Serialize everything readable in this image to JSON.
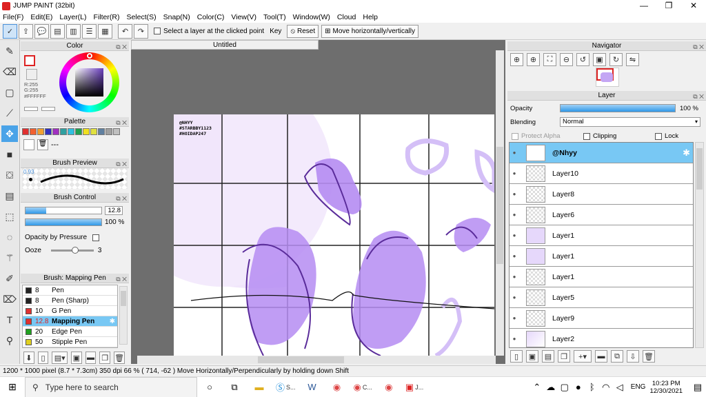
{
  "window": {
    "title": "JUMP PAINT (32bit)",
    "min": "—",
    "max": "❐",
    "close": "✕"
  },
  "menu": [
    "File(F)",
    "Edit(E)",
    "Layer(L)",
    "Filter(R)",
    "Select(S)",
    "Snap(N)",
    "Color(C)",
    "View(V)",
    "Tool(T)",
    "Window(W)",
    "Cloud",
    "Help"
  ],
  "toolbar": {
    "select_layer_label": "Select a layer at the clicked point",
    "key_label": "Key",
    "reset_label": "Reset",
    "move_label": "Move horizontally/vertically"
  },
  "color_panel": {
    "title": "Color",
    "r": "R:255",
    "g": "G:255",
    "hex": "#FFFFFF"
  },
  "palette_panel": {
    "title": "Palette",
    "extra": "---",
    "swatches": [
      "#e03030",
      "#f06030",
      "#f0a030",
      "#3030c0",
      "#a030c0",
      "#30a0a0",
      "#30c0e0",
      "#20a050",
      "#f0e020",
      "#e0e040",
      "#6080a0",
      "#a0a0a0",
      "#c0c0c0"
    ]
  },
  "brush_preview": {
    "title": "Brush Preview",
    "size_label": "0.93"
  },
  "brush_control": {
    "title": "Brush Control",
    "size_value": "12.8",
    "opacity_value": "100 %",
    "opacity_by_pressure": "Opacity by Pressure",
    "ooze_label": "Ooze",
    "ooze_value": "3"
  },
  "brush_list": {
    "title": "Brush: Mapping Pen",
    "items": [
      {
        "size": "8",
        "name": "Pen",
        "color": "#222222"
      },
      {
        "size": "8",
        "name": "Pen (Sharp)",
        "color": "#222222"
      },
      {
        "size": "10",
        "name": "G Pen",
        "color": "#e03030"
      },
      {
        "size": "12.8",
        "name": "Mapping Pen",
        "color": "#e03030"
      },
      {
        "size": "20",
        "name": "Edge Pen",
        "color": "#20a020"
      },
      {
        "size": "50",
        "name": "Stipple Pen",
        "color": "#e0d020"
      }
    ]
  },
  "canvas": {
    "tab_title": "Untitled",
    "watermark_lines": [
      "@NHYY",
      "#STARBBY1123",
      "#HOIDAP247"
    ]
  },
  "navigator": {
    "title": "Navigator"
  },
  "layer_panel": {
    "title": "Layer",
    "opacity_label": "Opacity",
    "opacity_value": "100 %",
    "blending_label": "Blending",
    "blending_value": "Normal",
    "protect_alpha": "Protect Alpha",
    "clipping": "Clipping",
    "lock": "Lock",
    "layers": [
      "@Nhyy",
      "Layer10",
      "Layer8",
      "Layer6",
      "Layer1",
      "Layer1",
      "Layer1",
      "Layer5",
      "Layer9",
      "Layer2"
    ]
  },
  "status": {
    "text": "1200 * 1000 pixel  (8.7 * 7.3cm)  350 dpi  66 %  ( 714, -62 )  Move Horizontally/Perpendicularly by holding down Shift"
  },
  "taskbar": {
    "search_placeholder": "Type here to search",
    "apps": [
      "S...",
      "C...",
      "J..."
    ],
    "lang": "ENG",
    "time": "10:23 PM",
    "date": "12/30/2021"
  },
  "colors": {
    "accent": "#78c8f4",
    "purple": "#a87cf0",
    "canvas_bg": "#6e6e6e"
  }
}
